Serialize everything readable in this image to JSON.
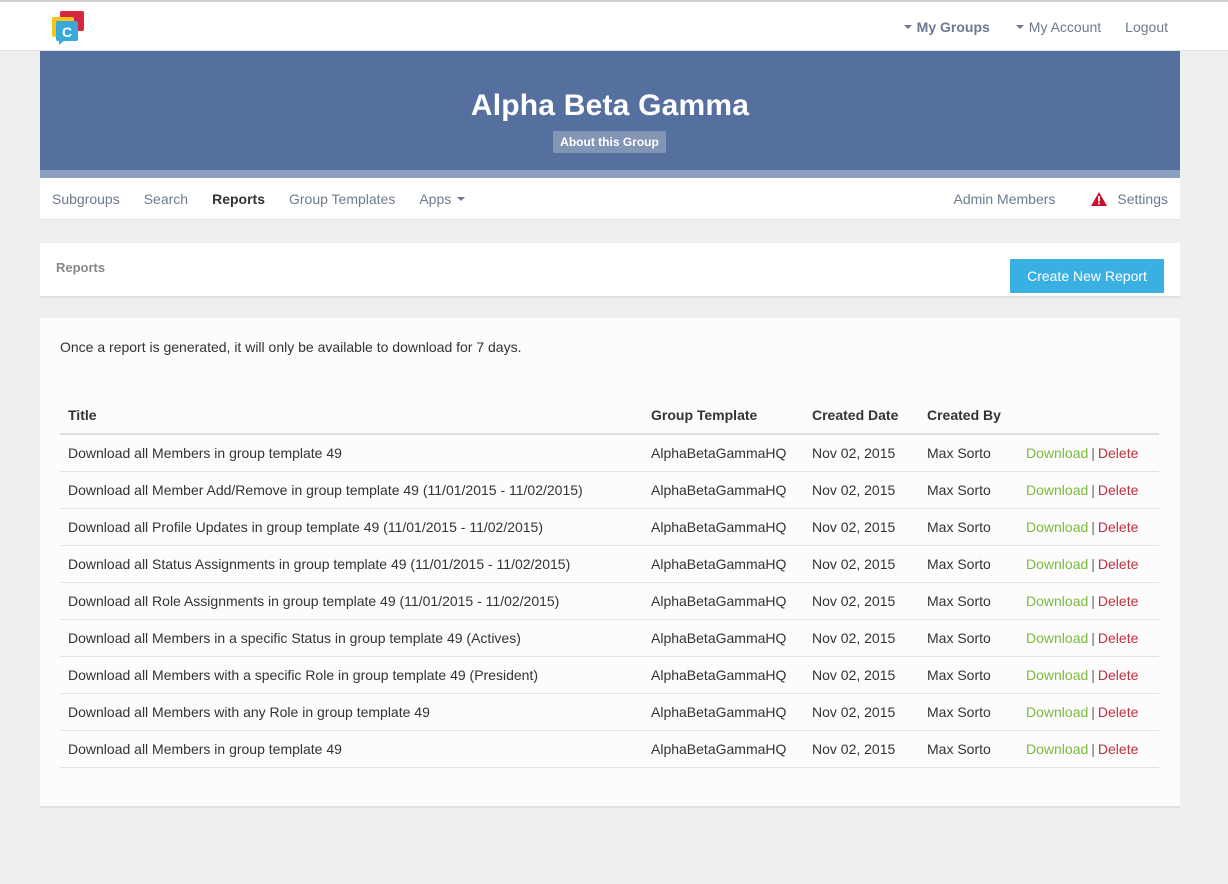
{
  "topbar": {
    "my_groups": "My Groups",
    "my_account": "My Account",
    "logout": "Logout"
  },
  "banner": {
    "title": "Alpha Beta Gamma",
    "about_button": "About this Group"
  },
  "subnav": {
    "items": [
      "Subgroups",
      "Search",
      "Reports",
      "Group Templates",
      "Apps"
    ],
    "admin_members": "Admin Members",
    "settings": "Settings"
  },
  "reports_header": {
    "title": "Reports",
    "create_button": "Create New Report"
  },
  "main": {
    "notice": "Once a report is generated, it will only be available to download for 7 days.",
    "columns": [
      "Title",
      "Group Template",
      "Created Date",
      "Created By",
      ""
    ],
    "download_label": "Download",
    "delete_label": "Delete",
    "separator": "|",
    "rows": [
      {
        "title": "Download all Members in group template 49",
        "template": "AlphaBetaGammaHQ",
        "date": "Nov 02, 2015",
        "by": "Max Sorto"
      },
      {
        "title": "Download all Member Add/Remove in group template 49 (11/01/2015 - 11/02/2015)",
        "template": "AlphaBetaGammaHQ",
        "date": "Nov 02, 2015",
        "by": "Max Sorto"
      },
      {
        "title": "Download all Profile Updates in group template 49 (11/01/2015 - 11/02/2015)",
        "template": "AlphaBetaGammaHQ",
        "date": "Nov 02, 2015",
        "by": "Max Sorto"
      },
      {
        "title": "Download all Status Assignments in group template 49 (11/01/2015 - 11/02/2015)",
        "template": "AlphaBetaGammaHQ",
        "date": "Nov 02, 2015",
        "by": "Max Sorto"
      },
      {
        "title": "Download all Role Assignments in group template 49 (11/01/2015 - 11/02/2015)",
        "template": "AlphaBetaGammaHQ",
        "date": "Nov 02, 2015",
        "by": "Max Sorto"
      },
      {
        "title": "Download all Members in a specific Status in group template 49 (Actives)",
        "template": "AlphaBetaGammaHQ",
        "date": "Nov 02, 2015",
        "by": "Max Sorto"
      },
      {
        "title": "Download all Members with a specific Role in group template 49 (President)",
        "template": "AlphaBetaGammaHQ",
        "date": "Nov 02, 2015",
        "by": "Max Sorto"
      },
      {
        "title": "Download all Members with any Role in group template 49",
        "template": "AlphaBetaGammaHQ",
        "date": "Nov 02, 2015",
        "by": "Max Sorto"
      },
      {
        "title": "Download all Members in group template 49",
        "template": "AlphaBetaGammaHQ",
        "date": "Nov 02, 2015",
        "by": "Max Sorto"
      }
    ]
  },
  "colors": {
    "banner": "#55709e",
    "accent_button": "#3ab0e2",
    "download": "#7bba3d",
    "delete": "#c0303f",
    "warning": "#c8102e"
  },
  "icons": {
    "logo": "chat-bubbles-logo-icon",
    "warning": "warning-triangle-icon",
    "caret": "caret-down-icon"
  }
}
